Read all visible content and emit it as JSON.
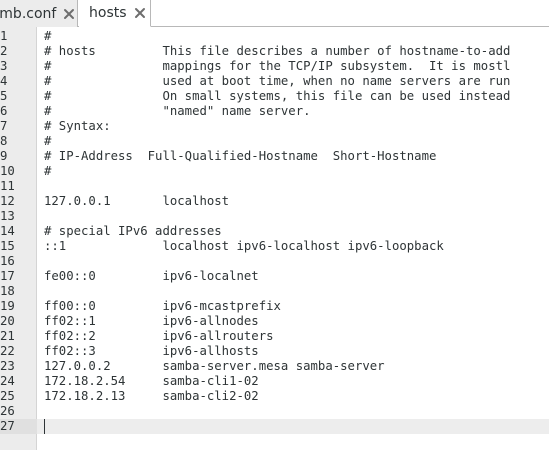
{
  "tabs": [
    {
      "label": "smb.conf",
      "active": false
    },
    {
      "label": "hosts",
      "active": true
    }
  ],
  "editor": {
    "current_line": 27,
    "lines": [
      {
        "n": "1",
        "text": "#"
      },
      {
        "n": "2",
        "text": "# hosts         This file describes a number of hostname-to-add"
      },
      {
        "n": "3",
        "text": "#               mappings for the TCP/IP subsystem.  It is mostl"
      },
      {
        "n": "4",
        "text": "#               used at boot time, when no name servers are run"
      },
      {
        "n": "5",
        "text": "#               On small systems, this file can be used instead"
      },
      {
        "n": "6",
        "text": "#               \"named\" name server."
      },
      {
        "n": "7",
        "text": "# Syntax:"
      },
      {
        "n": "8",
        "text": "#"
      },
      {
        "n": "9",
        "text": "# IP-Address  Full-Qualified-Hostname  Short-Hostname"
      },
      {
        "n": "10",
        "text": "#"
      },
      {
        "n": "11",
        "text": ""
      },
      {
        "n": "12",
        "text": "127.0.0.1       localhost"
      },
      {
        "n": "13",
        "text": ""
      },
      {
        "n": "14",
        "text": "# special IPv6 addresses"
      },
      {
        "n": "15",
        "text": "::1             localhost ipv6-localhost ipv6-loopback"
      },
      {
        "n": "16",
        "text": ""
      },
      {
        "n": "17",
        "text": "fe00::0         ipv6-localnet"
      },
      {
        "n": "18",
        "text": ""
      },
      {
        "n": "19",
        "text": "ff00::0         ipv6-mcastprefix"
      },
      {
        "n": "20",
        "text": "ff02::1         ipv6-allnodes"
      },
      {
        "n": "21",
        "text": "ff02::2         ipv6-allrouters"
      },
      {
        "n": "22",
        "text": "ff02::3         ipv6-allhosts"
      },
      {
        "n": "23",
        "text": "127.0.0.2       samba-server.mesa samba-server"
      },
      {
        "n": "24",
        "text": "172.18.2.54     samba-cli1-02"
      },
      {
        "n": "25",
        "text": "172.18.2.13     samba-cli2-02"
      },
      {
        "n": "26",
        "text": ""
      },
      {
        "n": "27",
        "text": ""
      }
    ]
  },
  "colors": {
    "tab_bar_bg": "#ececec",
    "gutter_bg": "#ececec",
    "text": "#2e3436",
    "current_line_bg": "#ededed"
  }
}
